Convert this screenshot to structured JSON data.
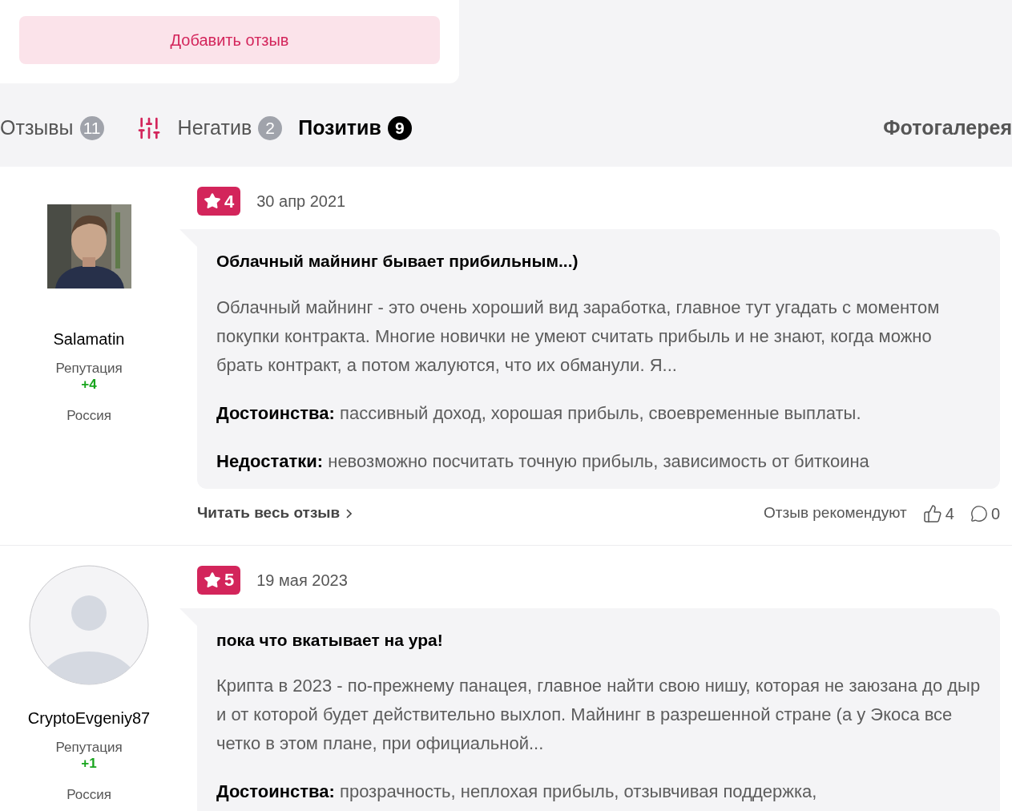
{
  "add_review_button": "Добавить отзыв",
  "tabs": [
    {
      "kind": "tab",
      "label": "Отзывы",
      "count": "11",
      "selected": false
    },
    {
      "kind": "filter"
    },
    {
      "kind": "tab",
      "label": "Негатив",
      "count": "2",
      "selected": false
    },
    {
      "kind": "tab",
      "label": "Позитив",
      "count": "9",
      "selected": true
    }
  ],
  "gallery_link": "Фотогалерея",
  "reviews": [
    {
      "author": "Salamatin",
      "reputation_label": "Репутация",
      "reputation": "+4",
      "country": "Россия",
      "rating": "4",
      "date": "30 апр 2021",
      "title": "Облачный майнинг бывает прибильным...)",
      "text": "Облачный майнинг - это очень хороший вид заработка, главное тут угадать с моментом покупки контракта. Многие новички не умеют считать прибыль и не знают, когда можно брать контракт, а потом жалуются, что их обманули. Я...",
      "pros": "**Достоинства:** пассивный доход, хорошая прибыль, своевременные выплаты.",
      "cons": "**Недостатки:** невозможно посчитать точную прибыль, зависимость от биткоина",
      "read_more": "Читать весь отзыв",
      "recommend_label": "Отзыв рекомендуют",
      "likes": "4",
      "comments": "0"
    },
    {
      "avatar": {
        "kind": "default"
      },
      "author": "CryptoEvgeniy87",
      "reputation_label": "Репутация",
      "reputation": "+1",
      "country": "Россия",
      "rating": "5",
      "date": "19 мая 2023",
      "title": "пока что вкатывает на ура!",
      "text": "Крипта в 2023 - по-прежнему панацея, главное найти свою нишу, которая не заюзана до дыр и от которой будет действительно выхлоп. Майнинг в разрешенной стране (а у Экоса все четко в этом плане, при официальной...",
      "pros": "**Достоинства:** прозрачность, неплохая прибыль, отзывчивая поддержка,"
    }
  ]
}
